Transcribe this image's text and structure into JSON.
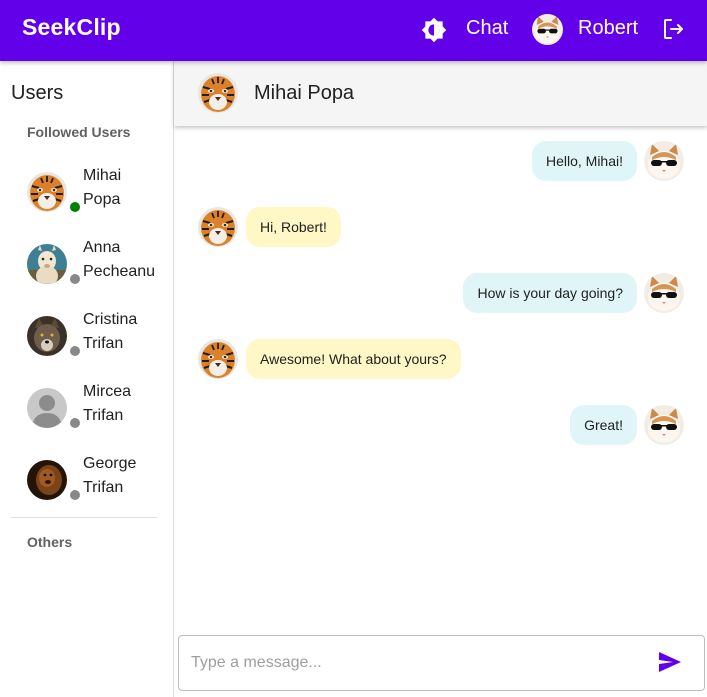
{
  "app": {
    "logo": "SeekClip"
  },
  "nav": {
    "chat_label": "Chat",
    "user_name": "Robert"
  },
  "sidebar": {
    "title": "Users",
    "followed_label": "Followed Users",
    "others_label": "Others",
    "users": [
      {
        "first": "Mihai",
        "last": "Popa",
        "status": "online"
      },
      {
        "first": "Anna",
        "last": "Pecheanu",
        "status": "offline"
      },
      {
        "first": "Cristina",
        "last": "Trifan",
        "status": "offline"
      },
      {
        "first": "Mircea",
        "last": "Trifan",
        "status": "offline"
      },
      {
        "first": "George",
        "last": "Trifan",
        "status": "offline"
      }
    ]
  },
  "chat": {
    "contact_name": "Mihai Popa",
    "messages": [
      {
        "from": "me",
        "text": "Hello, Mihai!"
      },
      {
        "from": "them",
        "text": "Hi, Robert!"
      },
      {
        "from": "me",
        "text": "How is your day going?"
      },
      {
        "from": "them",
        "text": "Awesome! What about yours?"
      },
      {
        "from": "me",
        "text": "Great!"
      }
    ],
    "input_placeholder": "Type a message..."
  },
  "colors": {
    "brand": "#6200ea",
    "online": "#008000",
    "offline": "#888888",
    "sent_bubble": "#e0f5f8",
    "received_bubble": "#fff7c6"
  },
  "icons": {
    "theme": "brightness-icon",
    "logout": "logout-icon",
    "send": "send-icon"
  }
}
